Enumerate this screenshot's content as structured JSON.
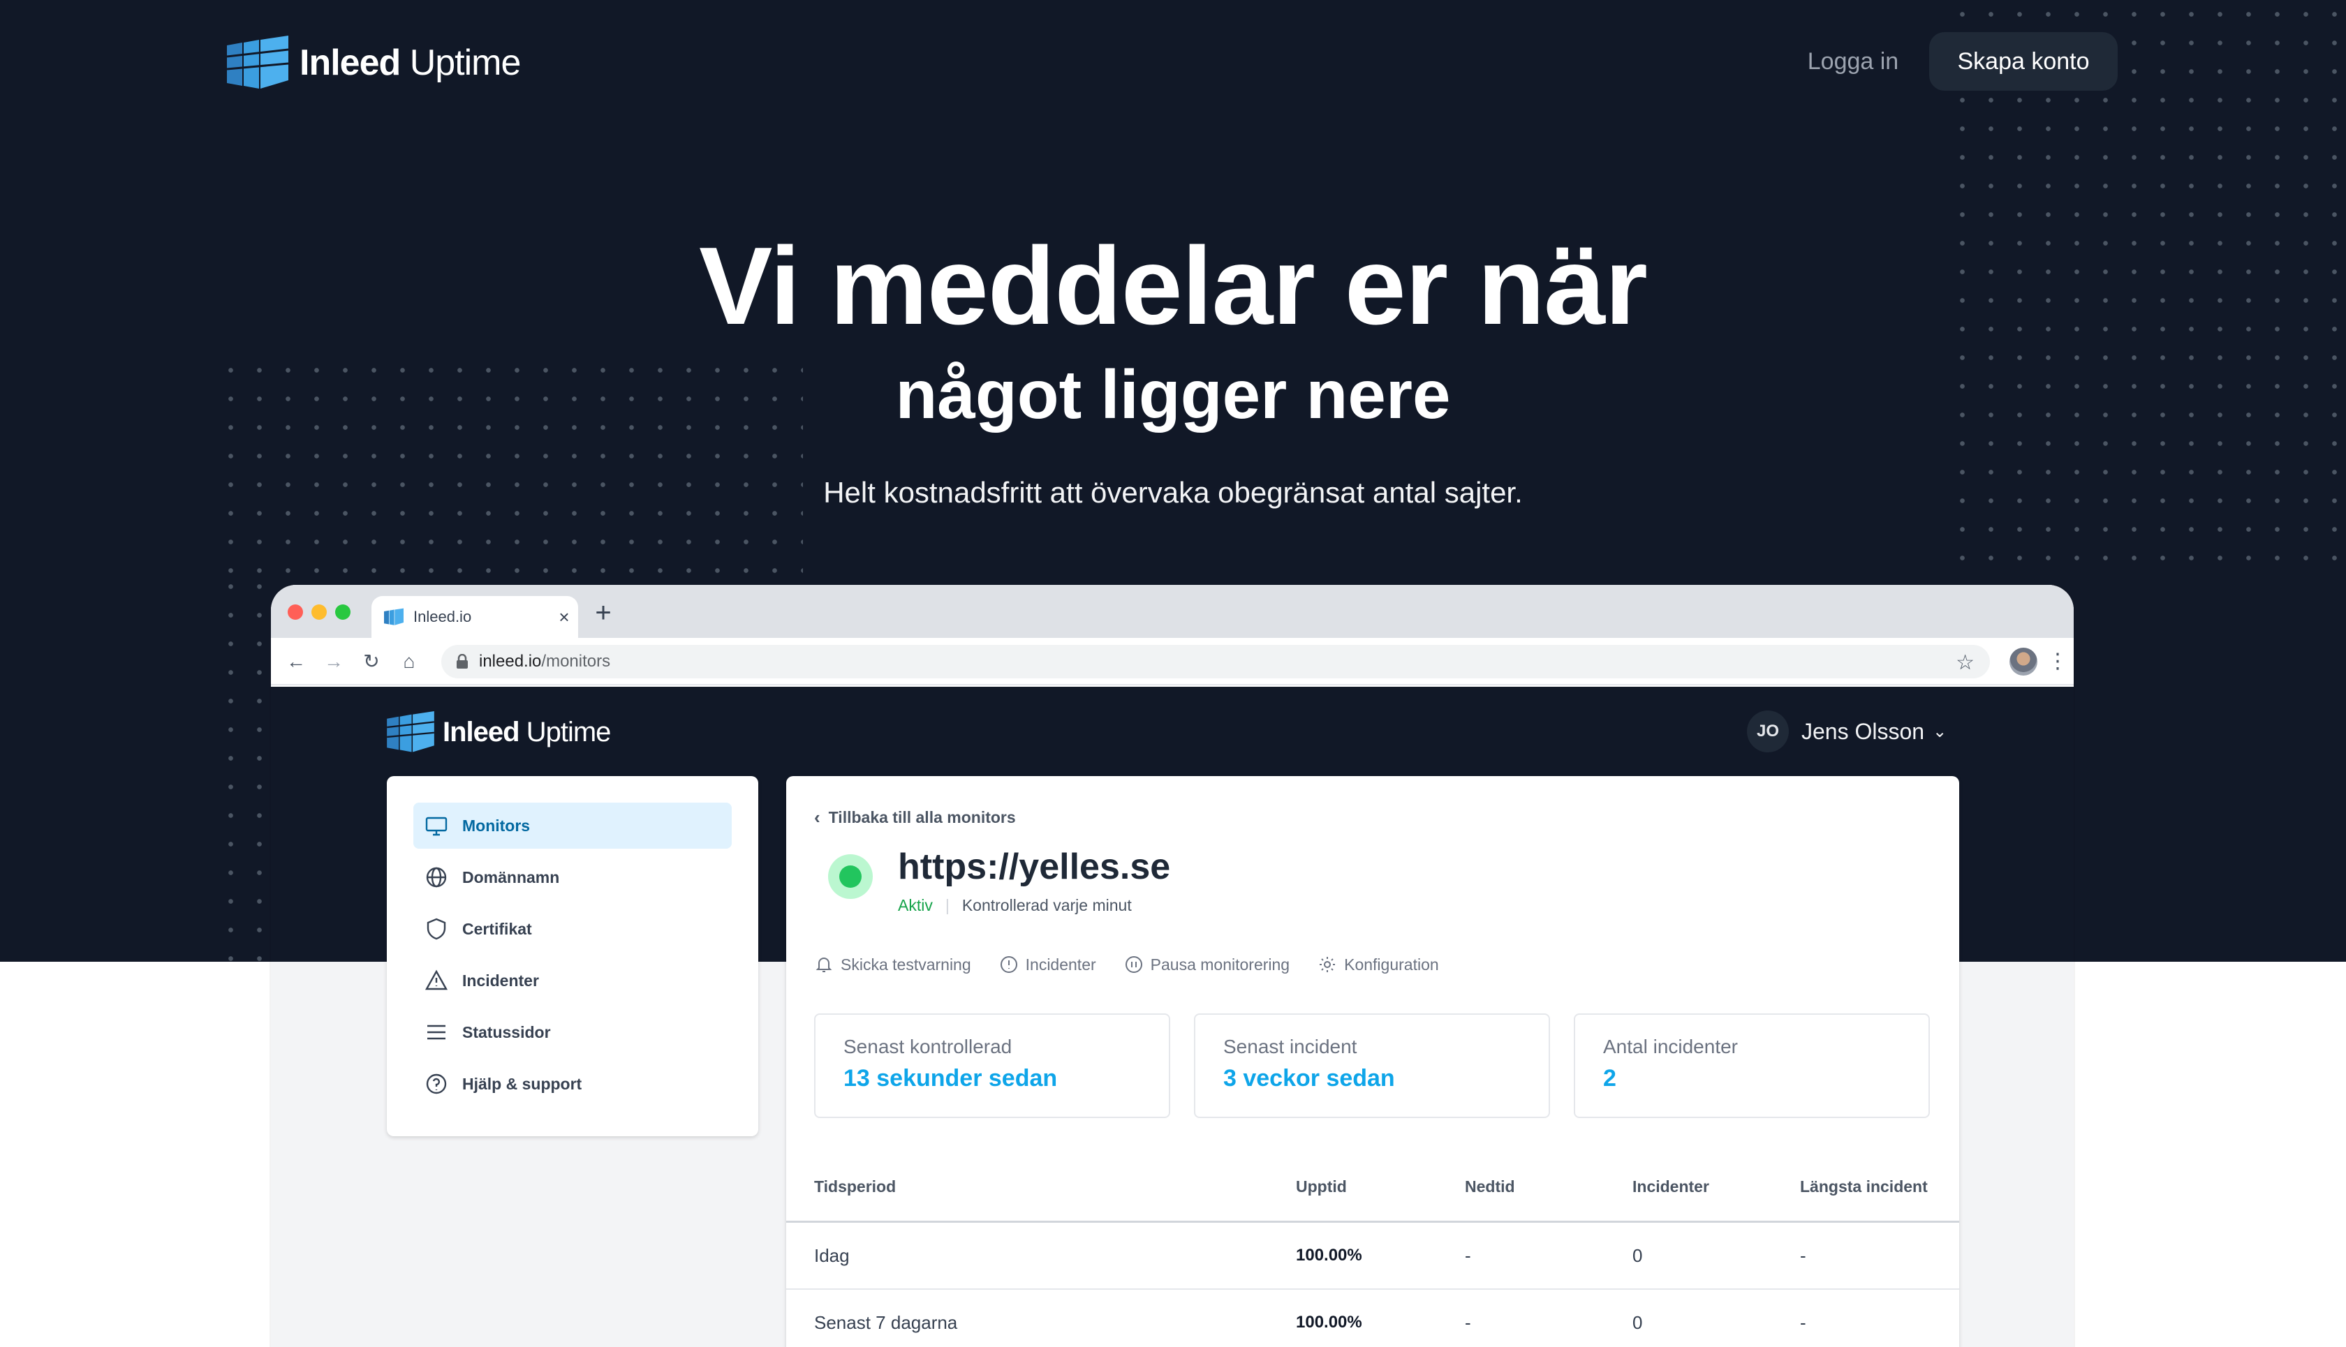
{
  "brand": {
    "name_bold": "Inleed",
    "name_light": " Uptime"
  },
  "header": {
    "login_label": "Logga in",
    "signup_label": "Skapa konto"
  },
  "hero": {
    "title": "Vi meddelar er när",
    "subtitle": "något ligger nere",
    "tagline": "Helt kostnadsfritt att övervaka obegränsat antal sajter."
  },
  "browser": {
    "tab_title": "Inleed.io",
    "tab_close": "×",
    "new_tab": "+",
    "url_host": "inleed.io",
    "url_path": "/monitors"
  },
  "app": {
    "user": {
      "initials": "JO",
      "name": "Jens Olsson"
    },
    "sidebar": [
      {
        "label": "Monitors",
        "icon": "monitor-icon",
        "active": true
      },
      {
        "label": "Domännamn",
        "icon": "globe-icon",
        "active": false
      },
      {
        "label": "Certifikat",
        "icon": "shield-icon",
        "active": false
      },
      {
        "label": "Incidenter",
        "icon": "warning-icon",
        "active": false
      },
      {
        "label": "Statussidor",
        "icon": "menu-icon",
        "active": false
      },
      {
        "label": "Hjälp & support",
        "icon": "help-icon",
        "active": false
      }
    ],
    "monitor": {
      "back_label": "Tillbaka till alla monitors",
      "url": "https://yelles.se",
      "status": "Aktiv",
      "frequency": "Kontrollerad varje minut"
    },
    "actions": [
      {
        "label": "Skicka testvarning",
        "icon": "bell-icon"
      },
      {
        "label": "Incidenter",
        "icon": "info-icon"
      },
      {
        "label": "Pausa monitorering",
        "icon": "pause-icon"
      },
      {
        "label": "Konfiguration",
        "icon": "gear-icon"
      }
    ],
    "stats": [
      {
        "label": "Senast kontrollerad",
        "value": "13 sekunder sedan"
      },
      {
        "label": "Senast incident",
        "value": "3 veckor sedan"
      },
      {
        "label": "Antal incidenter",
        "value": "2"
      }
    ],
    "table": {
      "headers": [
        "Tidsperiod",
        "Upptid",
        "Nedtid",
        "Incidenter",
        "Längsta incident"
      ],
      "rows": [
        [
          "Idag",
          "100.00%",
          "-",
          "0",
          "-"
        ],
        [
          "Senast 7 dagarna",
          "100.00%",
          "-",
          "0",
          "-"
        ]
      ]
    }
  },
  "colors": {
    "hero_bg": "#111827",
    "accent": "#0ea5e9",
    "active_green": "#16a34a",
    "logo_blue": "#3b82f6"
  }
}
